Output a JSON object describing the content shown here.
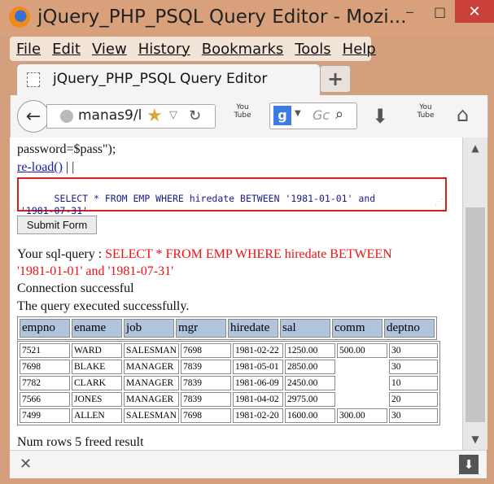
{
  "window": {
    "title": "jQuery_PHP_PSQL Query Editor - Mozi...",
    "controls": {
      "minimize": "‒",
      "maximize": "□",
      "close": "✕"
    }
  },
  "menu": [
    "File",
    "Edit",
    "View",
    "History",
    "Bookmarks",
    "Tools",
    "Help"
  ],
  "tab": {
    "label": "jQuery_PHP_PSQL Query Editor",
    "new_tab": "+"
  },
  "nav": {
    "url": "manas9/l",
    "search_placeholder": "Gc",
    "youtube_label_1": "You Tube",
    "youtube_label_2": "You Tube",
    "google_letter": "g"
  },
  "page": {
    "partial_line": "password=$pass\");",
    "reload_link": "re-load()",
    "reload_suffix": " | |",
    "sql_text": "SELECT * FROM EMP WHERE hiredate BETWEEN '1981-01-01' and\n'1981-07-31'",
    "submit_label": "Submit Form",
    "query_prefix": "Your sql-query : ",
    "query_line1": "SELECT * FROM EMP WHERE hiredate BETWEEN",
    "query_line2": "'1981-01-01' and '1981-07-31'",
    "connection_msg": "Connection successful",
    "executed_msg": "The query executed successfully.",
    "footer_msg": "Num rows 5 freed result"
  },
  "table": {
    "columns": [
      "empno",
      "ename",
      "job",
      "mgr",
      "hiredate",
      "sal",
      "comm",
      "deptno"
    ],
    "rows": [
      [
        "7521",
        "WARD",
        "SALESMAN",
        "7698",
        "1981-02-22",
        "1250.00",
        "500.00",
        "30"
      ],
      [
        "7698",
        "BLAKE",
        "MANAGER",
        "7839",
        "1981-05-01",
        "2850.00",
        "",
        "30"
      ],
      [
        "7782",
        "CLARK",
        "MANAGER",
        "7839",
        "1981-06-09",
        "2450.00",
        "",
        "10"
      ],
      [
        "7566",
        "JONES",
        "MANAGER",
        "7839",
        "1981-04-02",
        "2975.00",
        "",
        "20"
      ],
      [
        "7499",
        "ALLEN",
        "SALESMAN",
        "7698",
        "1981-02-20",
        "1600.00",
        "300.00",
        "30"
      ]
    ]
  }
}
